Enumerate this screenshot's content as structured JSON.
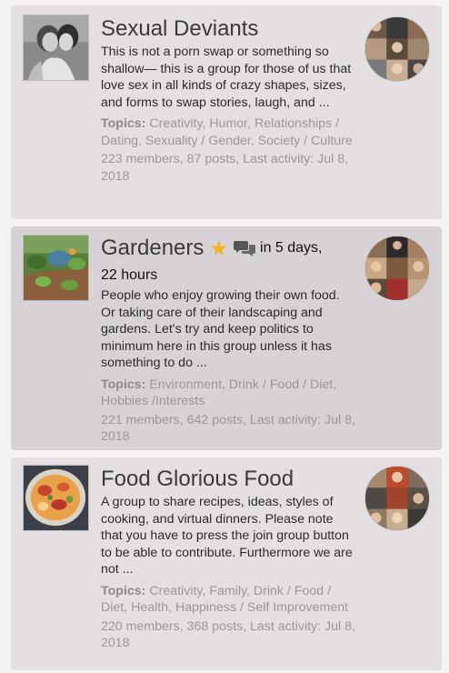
{
  "groups": [
    {
      "title": "Sexual Deviants",
      "description": "This is not a porn swap or something so shallow— this is a group for those of us that love sex in all kinds of crazy shapes, sizes, and forms to swap stories, laugh, and ...",
      "topics_label": "Topics:",
      "topics": "Creativity, Humor, Relationships / Dating, Sexuality / Gender, Society / Culture",
      "stats": "223 members, 87 posts, Last activity: Jul 8, 2018",
      "thumbnail_icon": "couple-photo",
      "avatars_icon": "member-avatars"
    },
    {
      "title": "Gardeners",
      "badge_icons": [
        "star-icon",
        "chat-bubbles-icon"
      ],
      "event_text": "in 5 days,",
      "event_text2": "22 hours",
      "description": "People who enjoy growing their own food. Or taking care of their landscaping and gardens. Let's try and keep politics to minimum here in this group unless it has something to do ...",
      "topics_label": "Topics:",
      "topics": "Environment, Drink / Food / Diet, Hobbies /Interests",
      "stats": "221 members, 642 posts, Last activity: Jul 8, 2018",
      "thumbnail_icon": "garden-photo",
      "avatars_icon": "member-avatars"
    },
    {
      "title": "Food Glorious Food",
      "description": "A group to share recipes, ideas, styles of cooking, and virtual dinners. Please note that you have to press the join group button to be able to contribute. Furthermore we are not ...",
      "topics_label": "Topics:",
      "topics": "Creativity, Family, Drink / Food / Diet, Health, Happiness / Self Improvement",
      "stats": "220 members, 368 posts, Last activity: Jul 8, 2018",
      "thumbnail_icon": "food-photo",
      "avatars_icon": "member-avatars"
    }
  ],
  "colors": {
    "card_bg": "#e3dfe3",
    "card_bg_alt": "#d6d2d6",
    "title": "#3a3a3a",
    "muted": "#9a979a",
    "star": "#f2b51c"
  }
}
